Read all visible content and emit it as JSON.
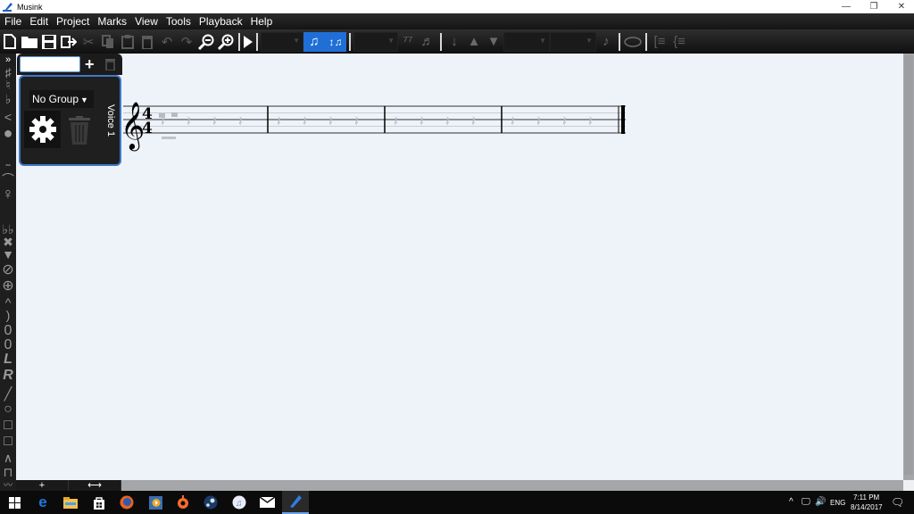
{
  "window": {
    "title": "Musink",
    "controls": {
      "minimize": "—",
      "restore": "❐",
      "close": "✕"
    }
  },
  "menu": [
    "File",
    "Edit",
    "Project",
    "Marks",
    "View",
    "Tools",
    "Playback",
    "Help"
  ],
  "toolbar": {
    "buttons": [
      {
        "name": "new-document",
        "glyph": "🗋",
        "enabled": true
      },
      {
        "name": "open-folder",
        "glyph": "📁",
        "enabled": true
      },
      {
        "name": "save",
        "glyph": "💾",
        "enabled": true
      },
      {
        "name": "export",
        "glyph": "⇪",
        "enabled": true
      },
      {
        "name": "cut",
        "glyph": "✂",
        "enabled": false
      },
      {
        "name": "copy",
        "glyph": "⎘",
        "enabled": false
      },
      {
        "name": "paste",
        "glyph": "📋",
        "enabled": false
      },
      {
        "name": "delete",
        "glyph": "🗑",
        "enabled": false
      },
      {
        "name": "undo",
        "glyph": "↶",
        "enabled": false
      },
      {
        "name": "redo",
        "glyph": "↷",
        "enabled": false
      },
      {
        "name": "zoom-out",
        "glyph": "⊖",
        "enabled": true
      },
      {
        "name": "zoom-in",
        "glyph": "⊕",
        "enabled": true
      },
      {
        "name": "play",
        "glyph": "▶",
        "enabled": true
      }
    ],
    "toggle_show_notes": "♫",
    "toggle_stem_direction": "↕♫",
    "other_icons": [
      "grace-notes",
      "piano",
      "stem-flip",
      "move-up",
      "move-down",
      "eighth-note",
      "slur",
      "bracket",
      "brace"
    ]
  },
  "voice_panel": {
    "name_value": "",
    "add_label": "+",
    "group_value": "No Group",
    "voice_label": "Voice 1"
  },
  "bottom_bar": {
    "add_label": "+",
    "resize_label": "⟷"
  },
  "score": {
    "clef": "treble",
    "time_signature": "4/4",
    "measures": 4
  },
  "taskbar": {
    "apps": [
      "start",
      "edge",
      "file-explorer",
      "store",
      "firefox",
      "media-player",
      "origin",
      "steam",
      "itunes",
      "mail",
      "musink"
    ],
    "tray": {
      "language": "ENG",
      "time": "7:11 PM",
      "date": "8/14/2017"
    }
  },
  "colors": {
    "accent": "#1f6fd6",
    "panel_border": "#3f78c8",
    "canvas": "#eef2f9"
  }
}
